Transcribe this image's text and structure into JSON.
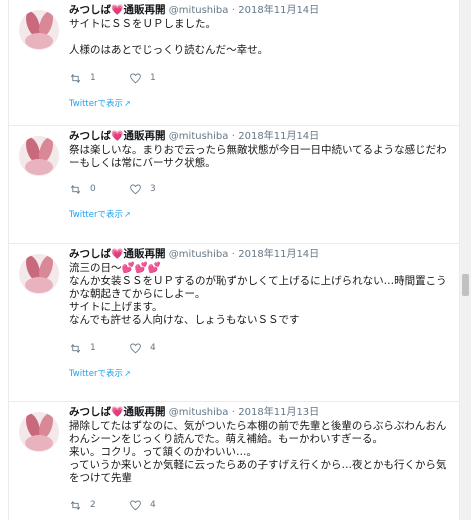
{
  "user": {
    "name": "みつしば",
    "emoji": "💗",
    "name_suffix": "通販再開",
    "handle": "@mitushiba",
    "dot": "·"
  },
  "tweets": [
    {
      "date": "2018年11月14日",
      "text": "サイトにＳＳをＵＰしました。\n\n人様のはあとでじっくり読むんだ〜幸せ。",
      "retweets": "1",
      "likes": "1",
      "view_label": "Twitterで表示"
    },
    {
      "date": "2018年11月14日",
      "text": "祭は楽しいな。まりおで云ったら無敵状態が今日一日中続いてるような感じだわーもしくは常にバーサク状態。",
      "retweets": "0",
      "likes": "3",
      "view_label": "Twitterで表示"
    },
    {
      "date": "2018年11月14日",
      "text_prefix": "流三の日〜",
      "text_hearts": "💕💕💕",
      "text": "なんか女装ＳＳをＵＰするのが恥ずかしくて上げるに上げられない…時間置こうかな朝起きてからにしよー。\nサイトに上げます。\nなんでも許せる人向けな、しょうもないＳＳです",
      "retweets": "1",
      "likes": "4",
      "view_label": "Twitterで表示"
    },
    {
      "date": "2018年11月13日",
      "text": "掃除してたはずなのに、気がついたら本棚の前で先輩と後輩のらぶらぶわんおんわんシーンをじっくり読んでた。萌え補給。もーかわいすぎーる。\n来い。コクリ。って頷くのかわいい…。\nっていうか来いとか気軽に云ったらあの子すげえ行くから…夜とかも行くから気をつけて先輩",
      "retweets": "2",
      "likes": "4"
    }
  ],
  "icons": {
    "retweet": "retweet-icon",
    "like": "heart-outline-icon",
    "external": "external-link-icon",
    "avatar": "rabbit-avatar"
  },
  "colors": {
    "link": "#1da1f2",
    "meta": "#657786",
    "text": "#14171a",
    "border": "#e6ecf0",
    "heart": "#e0245e"
  }
}
